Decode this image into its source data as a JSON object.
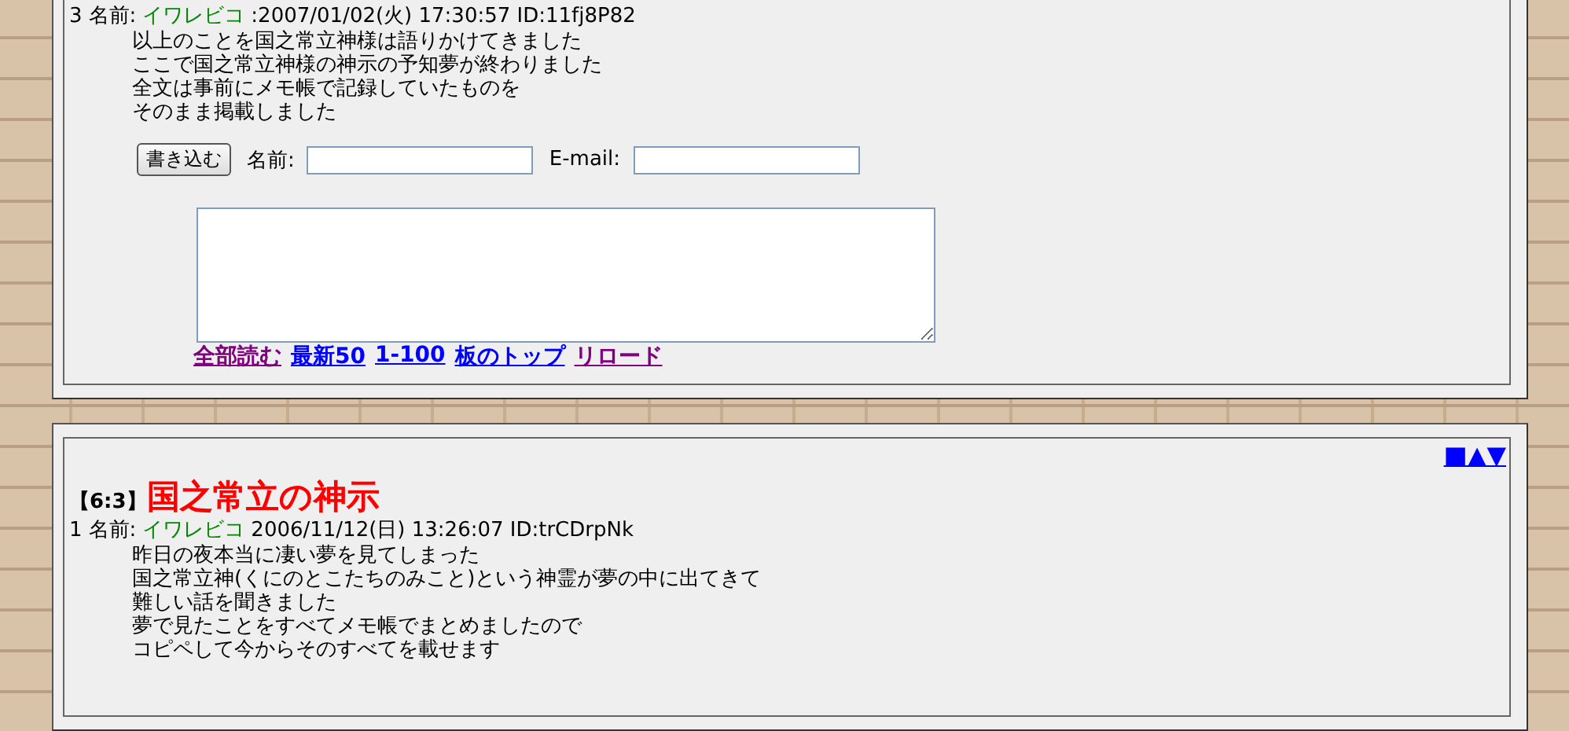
{
  "threads": [
    {
      "cut_top": true,
      "posts": [
        {
          "number": "3",
          "name_label": "名前:",
          "name": "イワレビコ",
          "meta": ":2007/01/02(火) 17:30:57 ID:11fj8P82",
          "lines": [
            "以上のことを国之常立神様は語りかけてきました",
            "ここで国之常立神様の神示の予知夢が終わりました",
            "全文は事前にメモ帳で記録していたものを",
            "そのまま掲載しました"
          ]
        }
      ],
      "reply_form": {
        "submit": "書き込む",
        "name_label": "名前:",
        "email_label": "E-mail:"
      },
      "links": [
        {
          "text": "全部読む",
          "visited": true
        },
        {
          "text": "最新50",
          "visited": false
        },
        {
          "text": "1-100",
          "visited": false
        },
        {
          "text": "板のトップ",
          "visited": false
        },
        {
          "text": "リロード",
          "visited": true
        }
      ]
    },
    {
      "cut_top": false,
      "nav": "■▲▼",
      "index": "【6:3】",
      "title": "国之常立の神示",
      "posts": [
        {
          "number": "1",
          "name_label": "名前:",
          "name": "イワレビコ",
          "meta": "2006/11/12(日) 13:26:07 ID:trCDrpNk",
          "lines": [
            "昨日の夜本当に凄い夢を見てしまった",
            "国之常立神(くにのとこたちのみこと)という神霊が夢の中に出てきて",
            "難しい話を聞きました",
            "夢で見たことをすべてメモ帳でまとめましたので",
            "コピペして今からそのすべてを載せます"
          ]
        }
      ]
    }
  ]
}
